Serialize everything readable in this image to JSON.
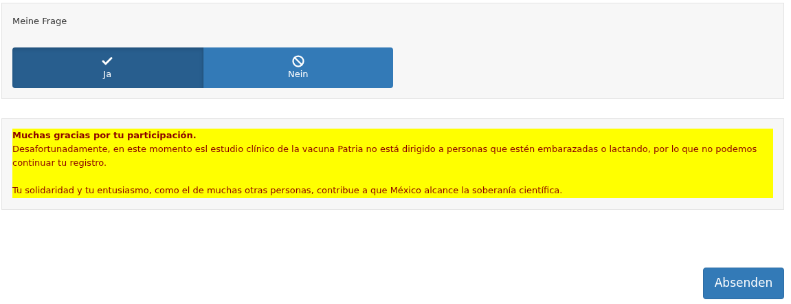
{
  "question": {
    "label": "Meine Frage",
    "options": [
      {
        "label": "Ja",
        "selected": true
      },
      {
        "label": "Nein",
        "selected": false
      }
    ]
  },
  "notice": {
    "title": "Muchas gracias por tu participación.",
    "paragraphs": [
      "Desafortunadamente, en este momento esl estudio clínico de la vacuna Patria no está dirigido a personas que estén embarazadas o lactando, por lo que no podemos continuar tu registro.",
      "Tu solidaridad y tu entusiasmo, como el de muchas otras personas, contribue a que México alcance la soberanía científica."
    ]
  },
  "submit": {
    "label": "Absenden"
  }
}
